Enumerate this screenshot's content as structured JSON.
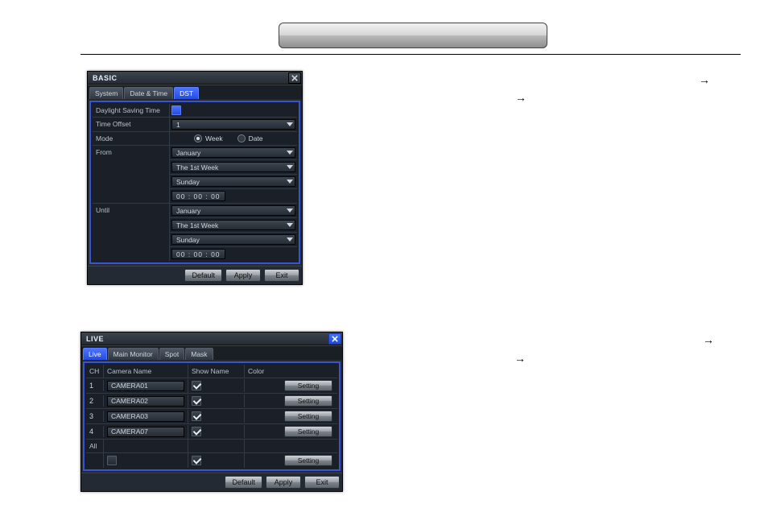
{
  "arrows": {
    "glyph": "→"
  },
  "basic": {
    "title": "BASIC",
    "tabs": [
      "System",
      "Date & Time",
      "DST"
    ],
    "active_tab": 2,
    "rows": {
      "dst_label": "Daylight Saving Time",
      "time_offset_label": "Time Offset",
      "time_offset_value": "1",
      "mode_label": "Mode",
      "mode_week": "Week",
      "mode_date": "Date",
      "from_label": "From",
      "until_label": "Until",
      "month": "January",
      "week": "The 1st Week",
      "day": "Sunday",
      "time": "00 : 00 : 00"
    },
    "buttons": {
      "default": "Default",
      "apply": "Apply",
      "exit": "Exit"
    }
  },
  "live": {
    "title": "LIVE",
    "tabs": [
      "Live",
      "Main Monitor",
      "Spot",
      "Mask"
    ],
    "active_tab": 0,
    "headers": {
      "ch": "CH",
      "camera_name": "Camera Name",
      "show_name": "Show Name",
      "color": "Color"
    },
    "rows": [
      {
        "ch": "1",
        "name": "CAMERA01"
      },
      {
        "ch": "2",
        "name": "CAMERA02"
      },
      {
        "ch": "3",
        "name": "CAMERA03"
      },
      {
        "ch": "4",
        "name": "CAMERA07"
      }
    ],
    "all_label": "All",
    "setting": "Setting",
    "buttons": {
      "default": "Default",
      "apply": "Apply",
      "exit": "Exit"
    }
  }
}
